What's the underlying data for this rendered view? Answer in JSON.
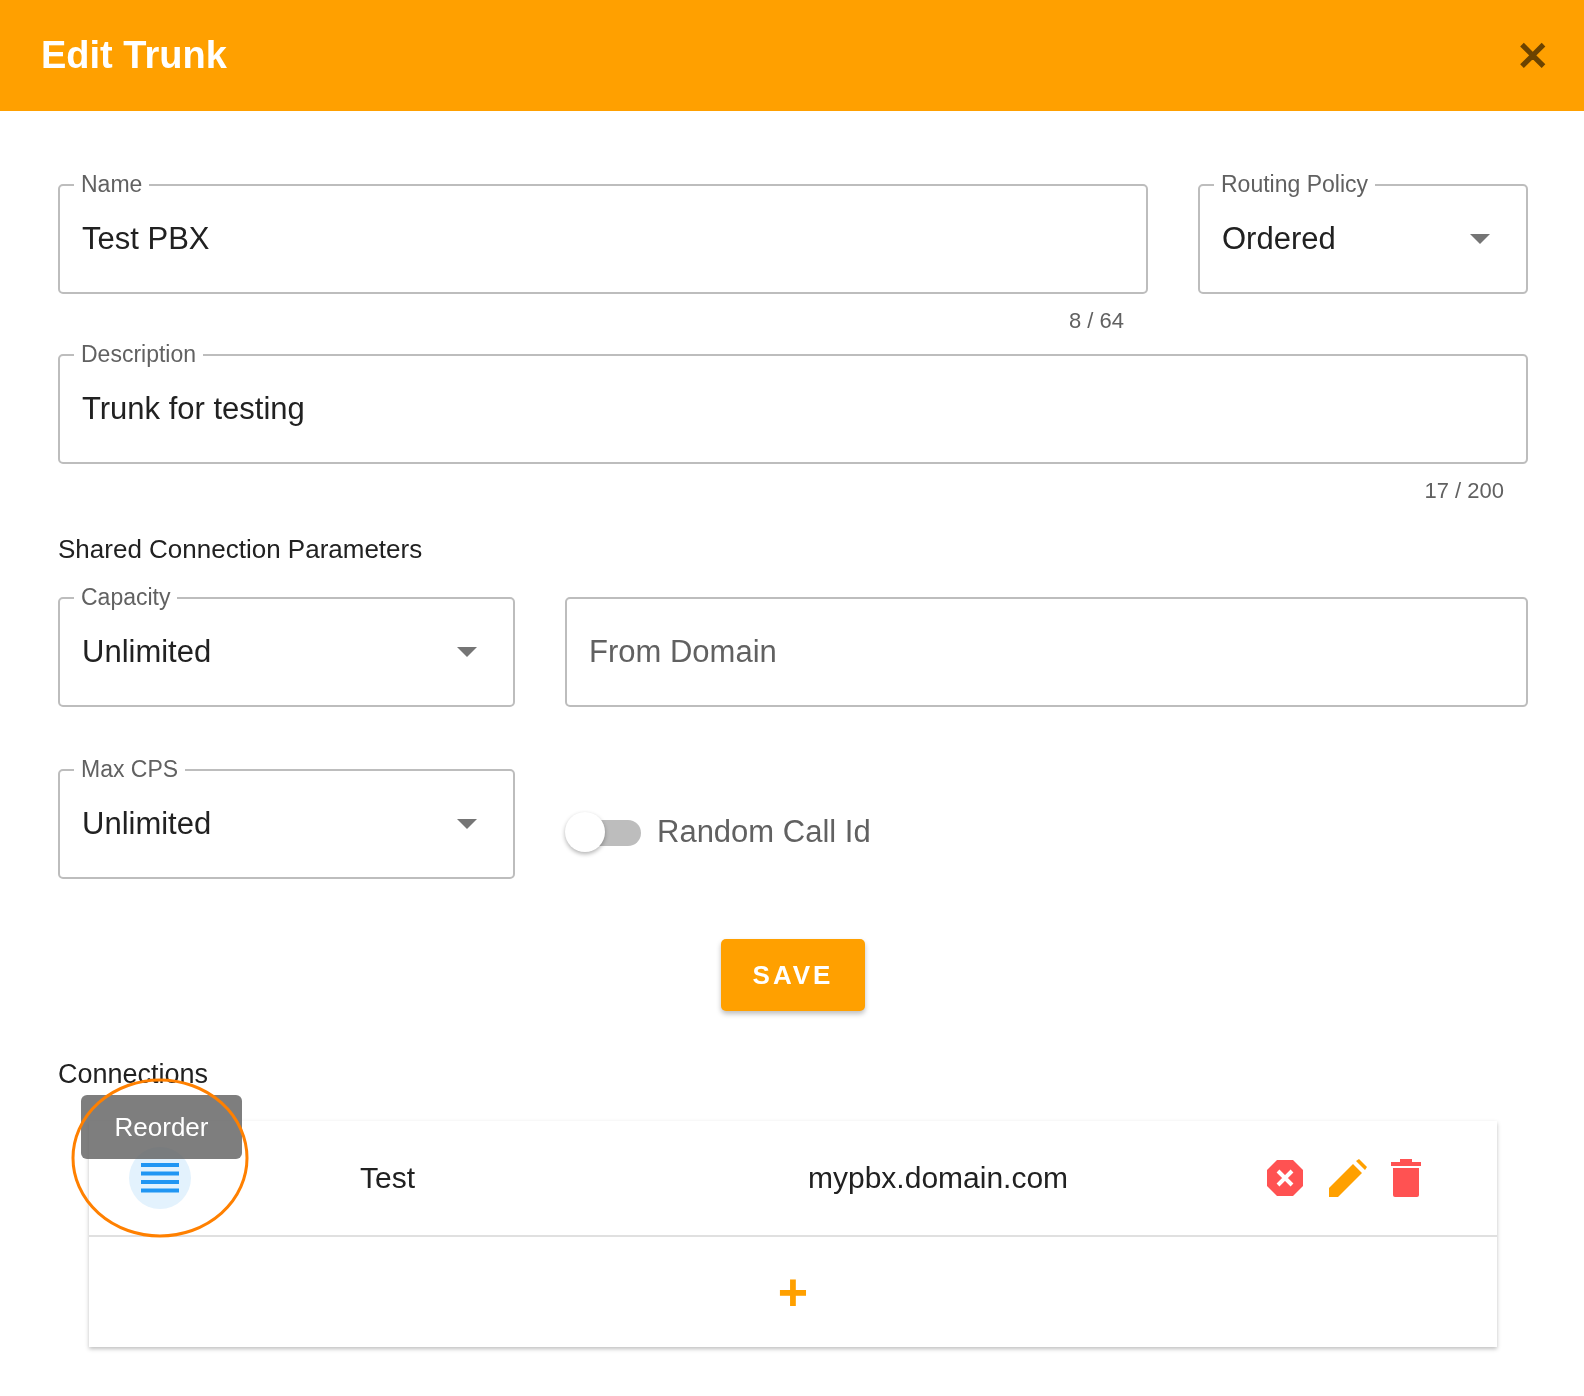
{
  "dialog": {
    "title": "Edit Trunk",
    "close": "✕"
  },
  "name_field": {
    "label": "Name",
    "value": "Test PBX",
    "counter": "8 / 64"
  },
  "routing_policy": {
    "label": "Routing Policy",
    "value": "Ordered"
  },
  "description_field": {
    "label": "Description",
    "value": "Trunk for testing",
    "counter": "17 / 200"
  },
  "shared_section": {
    "title": "Shared Connection Parameters"
  },
  "capacity": {
    "label": "Capacity",
    "value": "Unlimited"
  },
  "from_domain": {
    "placeholder": "From Domain"
  },
  "max_cps": {
    "label": "Max CPS",
    "value": "Unlimited"
  },
  "random_call_id": {
    "label": "Random Call Id",
    "on": false
  },
  "save_button": "SAVE",
  "connections": {
    "title": "Connections",
    "tooltip": "Reorder",
    "add": "+",
    "rows": [
      {
        "name": "Test",
        "domain": "mypbx.domain.com",
        "enabled": false
      }
    ]
  }
}
